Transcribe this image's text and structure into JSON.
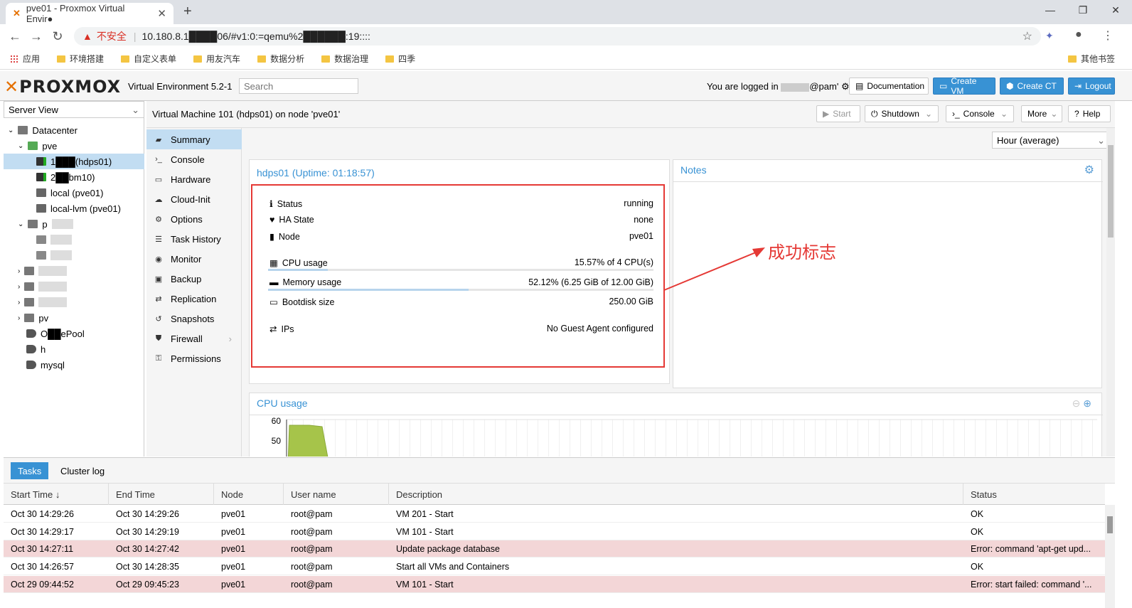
{
  "browser": {
    "tab_title": "pve01 - Proxmox Virtual Envir●",
    "url_warning": "不安全",
    "url": "10.180.8.1████06/#v1:0:=qemu%2██████:19::::",
    "bookmarks": [
      "应用",
      "环境搭建",
      "自定义表单",
      "用友汽车",
      "数据分析",
      "数据治理",
      "四季"
    ],
    "other_bookmarks": "其他书签"
  },
  "header": {
    "logo": "PROXMOX",
    "version": "Virtual Environment 5.2-1",
    "search_placeholder": "Search",
    "login_prefix": "You are logged in",
    "login_suffix": "@pam'",
    "buttons": {
      "documentation": "Documentation",
      "create_vm": "Create VM",
      "create_ct": "Create CT",
      "logout": "Logout"
    }
  },
  "tree": {
    "view": "Server View",
    "datacenter": "Datacenter",
    "nodes": [
      {
        "label": "pve"
      },
      {
        "label": "1███(hdps01)"
      },
      {
        "label": "2██bm10)"
      },
      {
        "label": "local (pve01)"
      },
      {
        "label": "local-lvm (pve01)"
      },
      {
        "label": "p"
      },
      {
        "label": "pv"
      },
      {
        "label": "O██ePool"
      },
      {
        "label": "h"
      },
      {
        "label": "mysql"
      }
    ]
  },
  "vm": {
    "title": "Virtual Machine 101 (hdps01) on node 'pve01'",
    "buttons": {
      "start": "Start",
      "shutdown": "Shutdown",
      "console": "Console",
      "more": "More",
      "help": "Help"
    }
  },
  "nav": [
    "Summary",
    "Console",
    "Hardware",
    "Cloud-Init",
    "Options",
    "Task History",
    "Monitor",
    "Backup",
    "Replication",
    "Snapshots",
    "Firewall",
    "Permissions"
  ],
  "time_select": "Hour (average)",
  "summary": {
    "title": "hdps01 (Uptime: 01:18:57)",
    "rows": {
      "status_label": "Status",
      "status_value": "running",
      "ha_label": "HA State",
      "ha_value": "none",
      "node_label": "Node",
      "node_value": "pve01",
      "cpu_label": "CPU usage",
      "cpu_value": "15.57% of 4 CPU(s)",
      "mem_label": "Memory usage",
      "mem_value": "52.12% (6.25 GiB of 12.00 GiB)",
      "disk_label": "Bootdisk size",
      "disk_value": "250.00 GiB",
      "ips_label": "IPs",
      "ips_value": "No Guest Agent configured"
    },
    "cpu_fraction": 0.1557,
    "mem_fraction": 0.5212
  },
  "notes": {
    "title": "Notes"
  },
  "cpu_chart": {
    "title": "CPU usage",
    "ticks": [
      "60",
      "50"
    ]
  },
  "annotation": "成功标志",
  "tasks": {
    "tabs": [
      "Tasks",
      "Cluster log"
    ],
    "columns": [
      "Start Time ↓",
      "End Time",
      "Node",
      "User name",
      "Description",
      "Status"
    ],
    "rows": [
      {
        "start": "Oct 30 14:29:26",
        "end": "Oct 30 14:29:26",
        "node": "pve01",
        "user": "root@pam",
        "desc": "VM 201 - Start",
        "status": "OK",
        "error": false
      },
      {
        "start": "Oct 30 14:29:17",
        "end": "Oct 30 14:29:19",
        "node": "pve01",
        "user": "root@pam",
        "desc": "VM 101 - Start",
        "status": "OK",
        "error": false
      },
      {
        "start": "Oct 30 14:27:11",
        "end": "Oct 30 14:27:42",
        "node": "pve01",
        "user": "root@pam",
        "desc": "Update package database",
        "status": "Error: command 'apt-get upd...",
        "error": true
      },
      {
        "start": "Oct 30 14:26:57",
        "end": "Oct 30 14:28:35",
        "node": "pve01",
        "user": "root@pam",
        "desc": "Start all VMs and Containers",
        "status": "OK",
        "error": false
      },
      {
        "start": "Oct 29 09:44:52",
        "end": "Oct 29 09:45:23",
        "node": "pve01",
        "user": "root@pam",
        "desc": "VM 101 - Start",
        "status": "Error: start failed: command '...",
        "error": true
      }
    ]
  },
  "colors": {
    "accent": "#3892d4",
    "selection": "#c2ddf2",
    "error_row": "#f3d6d7",
    "annotation": "#e53935",
    "logo_x": "#e57000"
  }
}
